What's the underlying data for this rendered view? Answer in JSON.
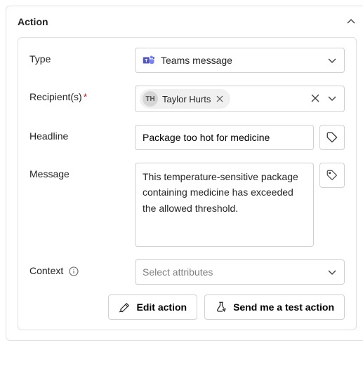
{
  "header": {
    "title": "Action"
  },
  "fields": {
    "type": {
      "label": "Type",
      "value": "Teams message"
    },
    "recipients": {
      "label": "Recipient(s)",
      "required_marker": "*",
      "chips": [
        {
          "initials": "TH",
          "name": "Taylor Hurts"
        }
      ]
    },
    "headline": {
      "label": "Headline",
      "value": "Package too hot for medicine"
    },
    "message": {
      "label": "Message",
      "value": "This temperature-sensitive package containing medicine has exceeded the allowed threshold."
    },
    "context": {
      "label": "Context",
      "placeholder": "Select attributes"
    }
  },
  "buttons": {
    "edit": "Edit action",
    "test": "Send me a test action"
  }
}
